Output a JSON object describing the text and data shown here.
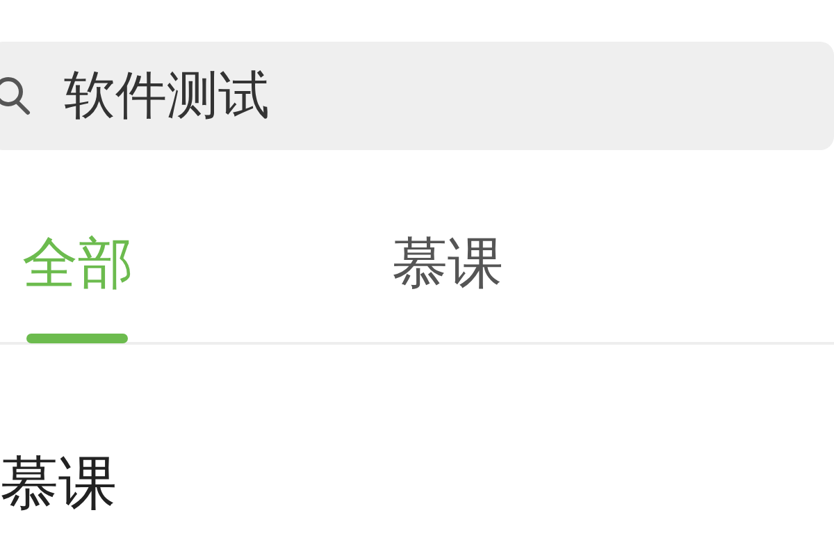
{
  "search": {
    "value": "软件测试"
  },
  "tabs": [
    {
      "label": "全部",
      "selected": true
    },
    {
      "label": "慕课",
      "selected": false
    }
  ],
  "section": {
    "title": "慕课"
  }
}
